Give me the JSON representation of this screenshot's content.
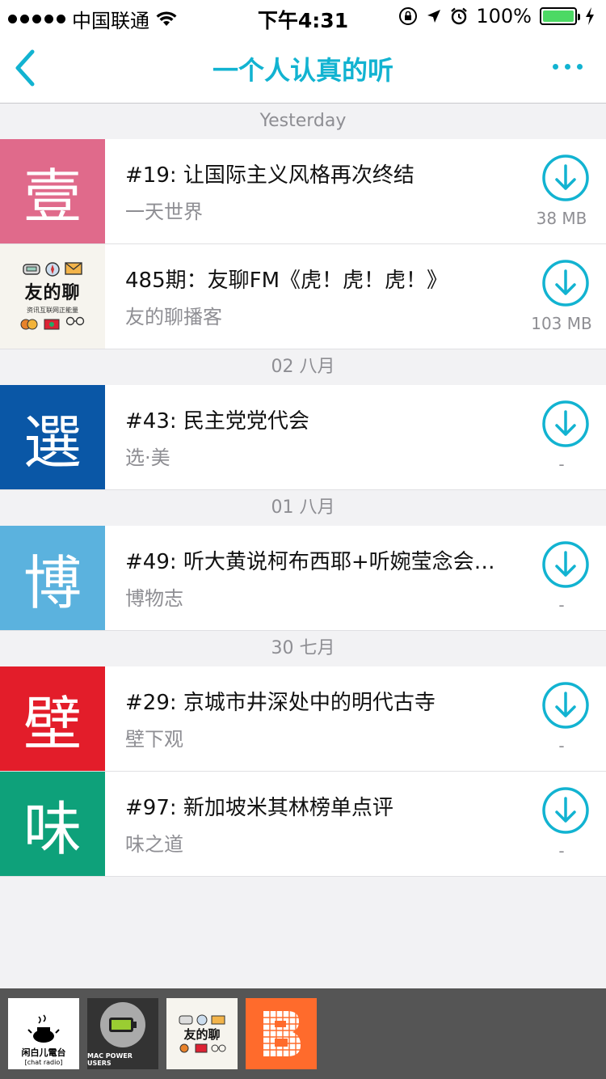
{
  "status_bar": {
    "carrier": "中国联通",
    "time": "下午4:31",
    "battery": "100%"
  },
  "nav": {
    "title": "一个人认真的听"
  },
  "colors": {
    "accent": "#12b3d1",
    "secondary_text": "#8e8e93"
  },
  "sections": [
    {
      "header": "Yesterday",
      "episodes": [
        {
          "thumb_char": "壹",
          "thumb_color": "#e06a8b",
          "title": "#19: 让国际主义风格再次终结",
          "podcast": "一天世界",
          "size": "38 MB"
        },
        {
          "thumb_char": "",
          "thumb_color": "#f6f4ee",
          "title": "485期：友聊FM《虎！虎！虎！》",
          "podcast": "友的聊播客",
          "size": "103 MB",
          "thumb_title": "友的聊",
          "thumb_sub": "资讯互联网正能量"
        }
      ]
    },
    {
      "header": "02 八月",
      "episodes": [
        {
          "thumb_char": "選",
          "thumb_color": "#0a57a6",
          "title": "#43: 民主党党代会",
          "podcast": "选·美",
          "size": "-"
        }
      ]
    },
    {
      "header": "01 八月",
      "episodes": [
        {
          "thumb_char": "博",
          "thumb_color": "#5bb2de",
          "title": "#49: 听大黄说柯布西耶+听婉莹念会…",
          "podcast": "博物志",
          "size": "-"
        }
      ]
    },
    {
      "header": "30 七月",
      "episodes": [
        {
          "thumb_char": "壁",
          "thumb_color": "#e31d2a",
          "title": "#29: 京城市井深处中的明代古寺",
          "podcast": "壁下观",
          "size": "-"
        },
        {
          "thumb_char": "味",
          "thumb_color": "#0ea17a",
          "title": "#97: 新加坡米其林榜单点评",
          "podcast": "味之道",
          "size": "-"
        }
      ]
    }
  ],
  "dock": {
    "chat_radio_line1": "闲白儿電台",
    "chat_radio_line2": "[chat radio]",
    "mpu_label": "MAC POWER USERS",
    "youde_title": "友的聊"
  }
}
